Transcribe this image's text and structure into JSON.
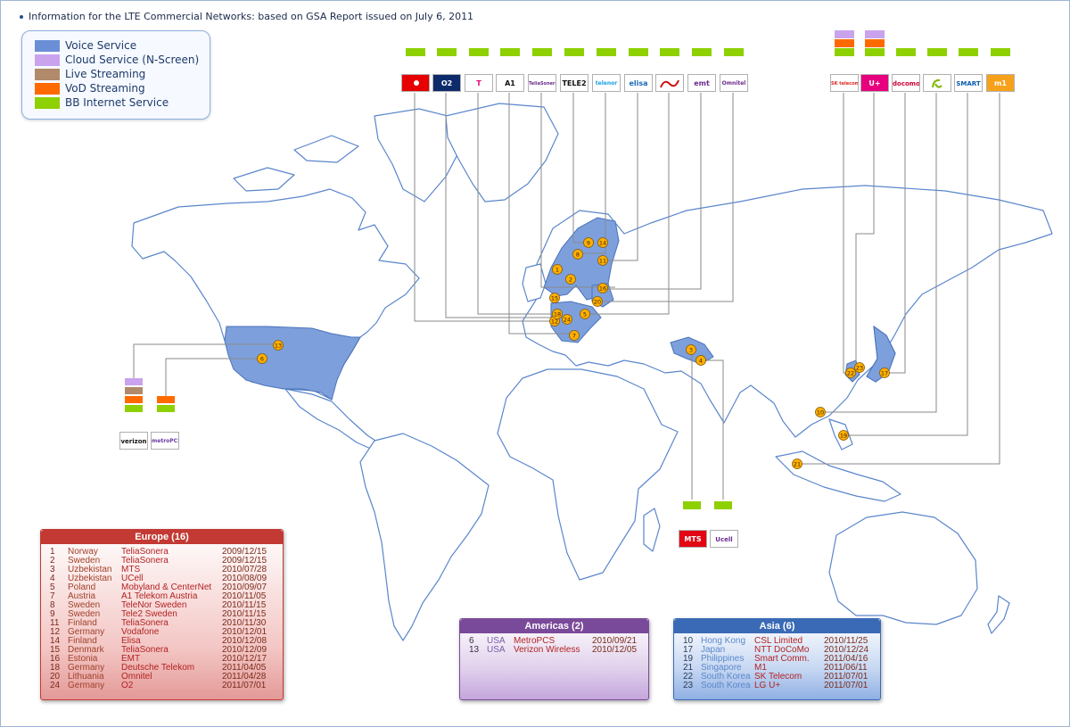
{
  "header": {
    "title": "Information for the LTE Commercial Networks: based on GSA Report issued on July 6, 2011"
  },
  "legend": {
    "items": [
      {
        "label": "Voice Service",
        "color": "#6b8fd6"
      },
      {
        "label": "Cloud Service (N-Screen)",
        "color": "#c9a3ee"
      },
      {
        "label": "Live Streaming",
        "color": "#b08a6a"
      },
      {
        "label": "VoD Streaming",
        "color": "#ff6a00"
      },
      {
        "label": "BB Internet Service",
        "color": "#8ed000"
      }
    ]
  },
  "map": {
    "highlight_color": "#7da0dc",
    "land_outline": "#5a86cc",
    "marker_color": "#ffb000",
    "line_color": "#8a8a8a",
    "markers": [
      {
        "num": "1"
      },
      {
        "num": "2"
      },
      {
        "num": "3"
      },
      {
        "num": "4"
      },
      {
        "num": "5"
      },
      {
        "num": "6"
      },
      {
        "num": "7"
      },
      {
        "num": "8"
      },
      {
        "num": "9"
      },
      {
        "num": "10"
      },
      {
        "num": "11"
      },
      {
        "num": "12"
      },
      {
        "num": "13"
      },
      {
        "num": "14"
      },
      {
        "num": "15"
      },
      {
        "num": "16"
      },
      {
        "num": "17"
      },
      {
        "num": "18"
      },
      {
        "num": "19"
      },
      {
        "num": "20"
      },
      {
        "num": "21"
      },
      {
        "num": "22"
      },
      {
        "num": "23"
      },
      {
        "num": "24"
      }
    ]
  },
  "operator_logos": {
    "europe_top": [
      {
        "name": "Vodafone",
        "label": "",
        "bg": "#e60000",
        "fg": "#ffffff",
        "icon": "vodafone-logo"
      },
      {
        "name": "O2",
        "label": "O2",
        "bg": "#0d2b6b",
        "fg": "#ffffff",
        "icon": "o2-logo"
      },
      {
        "name": "Deutsche Telekom",
        "label": "T",
        "bg": "#ffffff",
        "fg": "#e20074",
        "icon": "telekom-logo"
      },
      {
        "name": "A1 Telekom Austria",
        "label": "A1",
        "bg": "#ffffff",
        "fg": "#111111",
        "icon": "a1-logo"
      },
      {
        "name": "TeliaSonera",
        "label": "TeliaSonera",
        "bg": "#ffffff",
        "fg": "#6a2a8a",
        "icon": "teliasonera-logo"
      },
      {
        "name": "Tele2",
        "label": "TELE2",
        "bg": "#ffffff",
        "fg": "#111111",
        "icon": "tele2-logo"
      },
      {
        "name": "Telenor",
        "label": "telenor",
        "bg": "#ffffff",
        "fg": "#1aa0e0",
        "icon": "telenor-logo"
      },
      {
        "name": "Elisa",
        "label": "elisa",
        "bg": "#ffffff",
        "fg": "#1a6ab5",
        "icon": "elisa-logo"
      },
      {
        "name": "Mobyland",
        "label": "",
        "bg": "#ffffff",
        "fg": "#cc1111",
        "icon": "mobyland-logo"
      },
      {
        "name": "EMT",
        "label": "emt",
        "bg": "#ffffff",
        "fg": "#6a2a8a",
        "icon": "emt-logo"
      },
      {
        "name": "Omnitel",
        "label": "Omnitel",
        "bg": "#ffffff",
        "fg": "#6a2a8a",
        "icon": "omnitel-logo"
      }
    ],
    "asia_top": [
      {
        "name": "SK Telecom",
        "label": "SK telecom",
        "bg": "#ffffff",
        "fg": "#e2231a",
        "icon": "sktelecom-logo"
      },
      {
        "name": "LG U+",
        "label": "U+",
        "bg": "#e6007e",
        "fg": "#ffffff",
        "icon": "lguplus-logo"
      },
      {
        "name": "NTT DoCoMo",
        "label": "docomo",
        "bg": "#ffffff",
        "fg": "#cc0033",
        "icon": "docomo-logo"
      },
      {
        "name": "CSL Limited",
        "label": "",
        "bg": "#ffffff",
        "fg": "#7ab800",
        "icon": "csl-logo"
      },
      {
        "name": "Smart Comm.",
        "label": "SMART",
        "bg": "#ffffff",
        "fg": "#0a5ab0",
        "icon": "smart-logo"
      },
      {
        "name": "M1",
        "label": "m1",
        "bg": "#f7a11a",
        "fg": "#ffffff",
        "icon": "m1-logo"
      }
    ],
    "americas": [
      {
        "name": "Verizon Wireless",
        "label": "verizon",
        "bg": "#ffffff",
        "fg": "#111111",
        "icon": "verizon-logo"
      },
      {
        "name": "MetroPCS",
        "label": "metroPCS",
        "bg": "#ffffff",
        "fg": "#6a3aa0",
        "icon": "metropcs-logo"
      }
    ],
    "central_asia": [
      {
        "name": "MTS",
        "label": "MTS",
        "bg": "#e30613",
        "fg": "#ffffff",
        "icon": "mts-logo"
      },
      {
        "name": "UCell",
        "label": "Ucell",
        "bg": "#ffffff",
        "fg": "#6a2a8a",
        "icon": "ucell-logo"
      }
    ]
  },
  "tables": {
    "europe": {
      "title": "Europe (16)",
      "rows": [
        [
          "1",
          "Norway",
          "TeliaSonera",
          "2009/12/15"
        ],
        [
          "2",
          "Sweden",
          "TeliaSonera",
          "2009/12/15"
        ],
        [
          "3",
          "Uzbekistan",
          "MTS",
          "2010/07/28"
        ],
        [
          "4",
          "Uzbekistan",
          "UCell",
          "2010/08/09"
        ],
        [
          "5",
          "Poland",
          "Mobyland & CenterNet",
          "2010/09/07"
        ],
        [
          "7",
          "Austria",
          "A1 Telekom Austria",
          "2010/11/05"
        ],
        [
          "8",
          "Sweden",
          "TeleNor Sweden",
          "2010/11/15"
        ],
        [
          "9",
          "Sweden",
          "Tele2 Sweden",
          "2010/11/15"
        ],
        [
          "11",
          "Finland",
          "TeliaSonera",
          "2010/11/30"
        ],
        [
          "12",
          "Germany",
          "Vodafone",
          "2010/12/01"
        ],
        [
          "14",
          "Finland",
          "Elisa",
          "2010/12/08"
        ],
        [
          "15",
          "Denmark",
          "TeliaSonera",
          "2010/12/09"
        ],
        [
          "16",
          "Estonia",
          "EMT",
          "2010/12/17"
        ],
        [
          "18",
          "Germany",
          "Deutsche Telekom",
          "2011/04/05"
        ],
        [
          "20",
          "Lithuania",
          "Omnitel",
          "2011/04/28"
        ],
        [
          "24",
          "Germany",
          "O2",
          "2011/07/01"
        ]
      ]
    },
    "americas": {
      "title": "Americas (2)",
      "rows": [
        [
          "6",
          "USA",
          "MetroPCS",
          "2010/09/21"
        ],
        [
          "13",
          "USA",
          "Verizon Wireless",
          "2010/12/05"
        ]
      ]
    },
    "asia": {
      "title": "Asia (6)",
      "rows": [
        [
          "10",
          "Hong Kong",
          "CSL Limited",
          "2010/11/25"
        ],
        [
          "17",
          "Japan",
          "NTT DoCoMo",
          "2010/12/24"
        ],
        [
          "19",
          "Philippines",
          "Smart Comm.",
          "2011/04/16"
        ],
        [
          "21",
          "Singapore",
          "M1",
          "2011/06/11"
        ],
        [
          "22",
          "South Korea",
          "SK Telecom",
          "2011/07/01"
        ],
        [
          "23",
          "South Korea",
          "LG U+",
          "2011/07/01"
        ]
      ]
    }
  }
}
